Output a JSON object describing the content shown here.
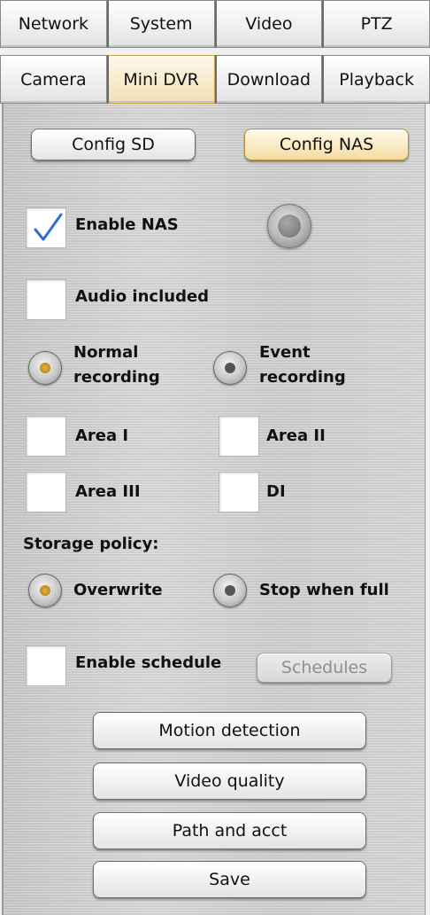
{
  "tabs_row1": [
    "Network",
    "System",
    "Video",
    "PTZ"
  ],
  "tabs_row2": [
    "Camera",
    "Mini DVR",
    "Download",
    "Playback"
  ],
  "active_tab_row2": "Mini DVR",
  "config_buttons": {
    "sd": "Config SD",
    "nas": "Config NAS",
    "active": "Config NAS"
  },
  "enable_nas": {
    "label": "Enable NAS",
    "checked": true
  },
  "audio_included": {
    "label": "Audio included",
    "checked": false
  },
  "recording_mode": {
    "normal": "Normal\nrecording",
    "normal_l1": "Normal",
    "normal_l2": "recording",
    "event_l1": "Event",
    "event_l2": "recording",
    "selected": "normal"
  },
  "areas": {
    "area1": "Area I",
    "area2": "Area II",
    "area3": "Area III",
    "di": "DI"
  },
  "storage_policy": {
    "label": "Storage policy:",
    "overwrite": "Overwrite",
    "stop": "Stop when full",
    "selected": "overwrite"
  },
  "schedule": {
    "label": "Enable schedule",
    "button": "Schedules"
  },
  "actions": {
    "motion": "Motion detection",
    "quality": "Video quality",
    "path": "Path and acct",
    "save": "Save"
  },
  "colors": {
    "accent_gold": "#f3dca0",
    "radio_on": "#e9b53b"
  }
}
